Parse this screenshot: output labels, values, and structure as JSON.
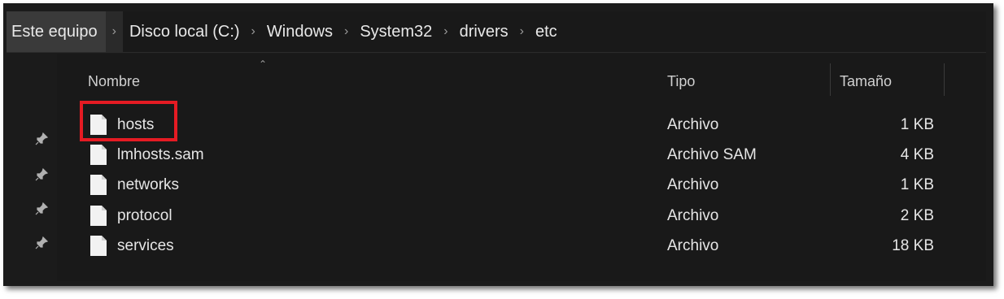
{
  "breadcrumb": {
    "items": [
      "Este equipo",
      "Disco local (C:)",
      "Windows",
      "System32",
      "drivers",
      "etc"
    ],
    "separator": "›"
  },
  "columns": {
    "name": "Nombre",
    "type": "Tipo",
    "size": "Tamaño"
  },
  "files": [
    {
      "name": "hosts",
      "type": "Archivo",
      "size": "1 KB"
    },
    {
      "name": "lmhosts.sam",
      "type": "Archivo SAM",
      "size": "4 KB"
    },
    {
      "name": "networks",
      "type": "Archivo",
      "size": "1 KB"
    },
    {
      "name": "protocol",
      "type": "Archivo",
      "size": "2 KB"
    },
    {
      "name": "services",
      "type": "Archivo",
      "size": "18 KB"
    }
  ],
  "colors": {
    "background": "#191919",
    "highlight": "#e51b23",
    "text": "#e6e6e6"
  }
}
